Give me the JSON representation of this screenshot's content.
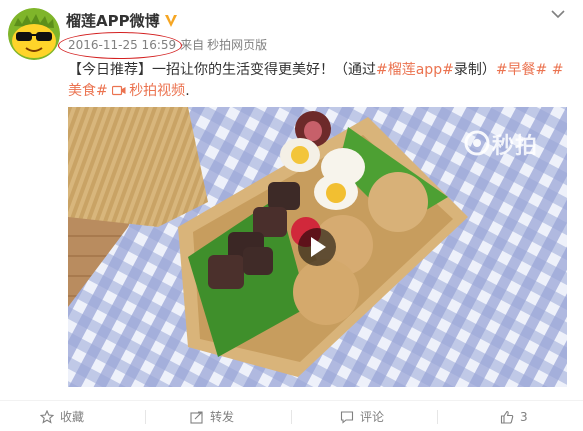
{
  "account": {
    "name": "榴莲APP微博"
  },
  "meta": {
    "time": "2016-11-25 16:59",
    "source_label": "来自",
    "source": "秒拍网页版"
  },
  "post": {
    "part1": "【今日推荐】一招让你的生活变得更美好！（通过",
    "tag1": "#榴莲app#",
    "part2": "录制）",
    "tag2": "#早餐#",
    "tag3": "#美食#",
    "video_link": "秒拍视频",
    "tail": "."
  },
  "media": {
    "watermark": "秒拍"
  },
  "footer": {
    "favorite": "收藏",
    "repost": "转发",
    "comment": "评论",
    "like_count": "3"
  },
  "colors": {
    "link": "#eb7350",
    "verified_badge": "#f6a623",
    "annotation_ring": "#d32020"
  }
}
